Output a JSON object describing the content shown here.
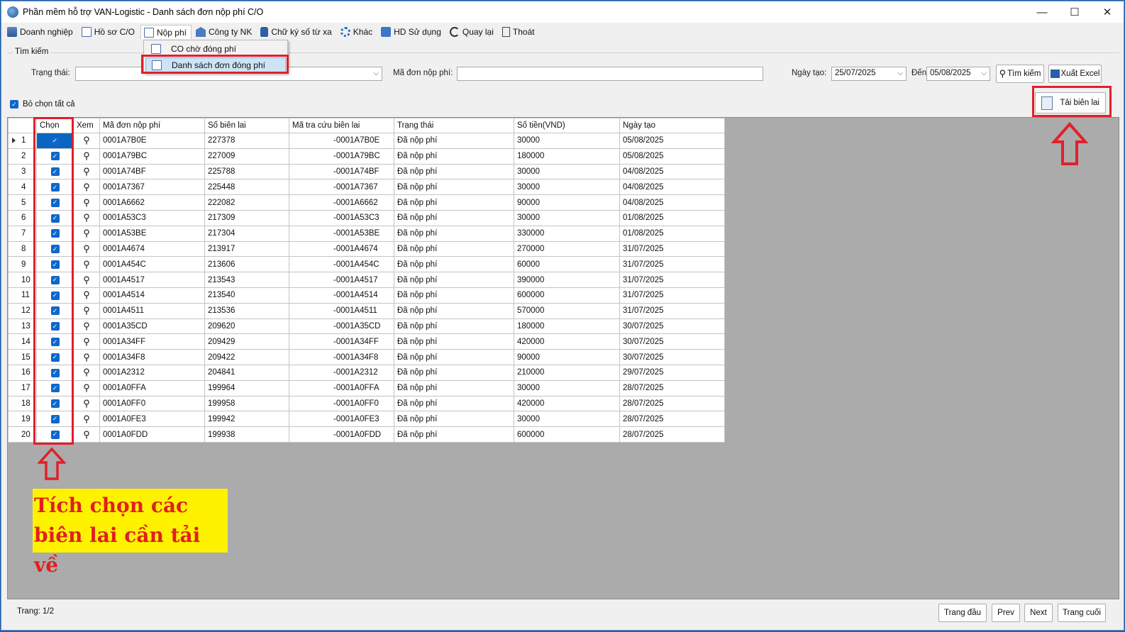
{
  "window": {
    "title": "Phần mềm hỗ trợ VAN-Logistic - Danh sách đơn nộp phí C/O",
    "controls": [
      "—",
      "☐",
      "✕"
    ]
  },
  "menu": [
    {
      "label": "Doanh nghiệp",
      "icon": "building-icon"
    },
    {
      "label": "Hồ sơ C/O",
      "icon": "document-icon"
    },
    {
      "label": "Nộp phí",
      "icon": "fee-document-icon"
    },
    {
      "label": "Công ty NK",
      "icon": "company-icon"
    },
    {
      "label": "Chữ ký số từ xa",
      "icon": "lock-icon"
    },
    {
      "label": "Khác",
      "icon": "gear-icon"
    },
    {
      "label": "HD Sử dụng",
      "icon": "book-icon"
    },
    {
      "label": "Quay lại",
      "icon": "back-icon"
    },
    {
      "label": "Thoát",
      "icon": "exit-icon"
    }
  ],
  "dropdown": {
    "items": [
      "CO chờ đóng phí",
      "Danh sách đơn đóng phí"
    ]
  },
  "search": {
    "legend": "Tìm kiếm",
    "status_label": "Trạng thái:",
    "status_value": "",
    "code_label": "Mã đơn nộp phí:",
    "code_value": "",
    "date_label": "Ngày tạo:",
    "date_from": "25/07/2025",
    "to_label": "Đến:",
    "date_to": "05/08/2025",
    "search_button": "Tìm kiếm",
    "excel_button": "Xuất Excel"
  },
  "select_all_label": "Bỏ chọn tất cả",
  "download_button": "Tải biên lai",
  "table": {
    "columns": [
      "Chọn",
      "Xem",
      "Mã đơn nộp phí",
      "Số biên lai",
      "Mã tra cứu biên lai",
      "Trạng thái",
      "Số tiền(VND)",
      "Ngày tạo"
    ],
    "rows": [
      [
        "1",
        "0001A7B0E",
        "227378",
        "-0001A7B0E",
        "Đã nộp phí",
        "30000",
        "05/08/2025"
      ],
      [
        "2",
        "0001A79BC",
        "227009",
        "-0001A79BC",
        "Đã nộp phí",
        "180000",
        "05/08/2025"
      ],
      [
        "3",
        "0001A74BF",
        "225788",
        "-0001A74BF",
        "Đã nộp phí",
        "30000",
        "04/08/2025"
      ],
      [
        "4",
        "0001A7367",
        "225448",
        "-0001A7367",
        "Đã nộp phí",
        "30000",
        "04/08/2025"
      ],
      [
        "5",
        "0001A6662",
        "222082",
        "-0001A6662",
        "Đã nộp phí",
        "90000",
        "04/08/2025"
      ],
      [
        "6",
        "0001A53C3",
        "217309",
        "-0001A53C3",
        "Đã nộp phí",
        "30000",
        "01/08/2025"
      ],
      [
        "7",
        "0001A53BE",
        "217304",
        "-0001A53BE",
        "Đã nộp phí",
        "330000",
        "01/08/2025"
      ],
      [
        "8",
        "0001A4674",
        "213917",
        "-0001A4674",
        "Đã nộp phí",
        "270000",
        "31/07/2025"
      ],
      [
        "9",
        "0001A454C",
        "213606",
        "-0001A454C",
        "Đã nộp phí",
        "60000",
        "31/07/2025"
      ],
      [
        "10",
        "0001A4517",
        "213543",
        "-0001A4517",
        "Đã nộp phí",
        "390000",
        "31/07/2025"
      ],
      [
        "11",
        "0001A4514",
        "213540",
        "-0001A4514",
        "Đã nộp phí",
        "600000",
        "31/07/2025"
      ],
      [
        "12",
        "0001A4511",
        "213536",
        "-0001A4511",
        "Đã nộp phí",
        "570000",
        "31/07/2025"
      ],
      [
        "13",
        "0001A35CD",
        "209620",
        "-0001A35CD",
        "Đã nộp phí",
        "180000",
        "30/07/2025"
      ],
      [
        "14",
        "0001A34FF",
        "209429",
        "-0001A34FF",
        "Đã nộp phí",
        "420000",
        "30/07/2025"
      ],
      [
        "15",
        "0001A34F8",
        "209422",
        "-0001A34F8",
        "Đã nộp phí",
        "90000",
        "30/07/2025"
      ],
      [
        "16",
        "0001A2312",
        "204841",
        "-0001A2312",
        "Đã nộp phí",
        "210000",
        "29/07/2025"
      ],
      [
        "17",
        "0001A0FFA",
        "199964",
        "-0001A0FFA",
        "Đã nộp phí",
        "30000",
        "28/07/2025"
      ],
      [
        "18",
        "0001A0FF0",
        "199958",
        "-0001A0FF0",
        "Đã nộp phí",
        "420000",
        "28/07/2025"
      ],
      [
        "19",
        "0001A0FE3",
        "199942",
        "-0001A0FE3",
        "Đã nộp phí",
        "30000",
        "28/07/2025"
      ],
      [
        "20",
        "0001A0FDD",
        "199938",
        "-0001A0FDD",
        "Đã nộp phí",
        "600000",
        "28/07/2025"
      ]
    ]
  },
  "annotation": {
    "line1": "Tích chọn các",
    "line2": "biên lai cần tải về"
  },
  "footer": {
    "page_label": "Trang: 1/2",
    "first": "Trang đầu",
    "prev": "Prev",
    "next": "Next",
    "last": "Trang cuối"
  },
  "colors": {
    "highlight_red": "#e0202a",
    "note_yellow": "#fff200",
    "checkbox_blue": "#0f67c9",
    "grid_gray": "#ababab"
  }
}
